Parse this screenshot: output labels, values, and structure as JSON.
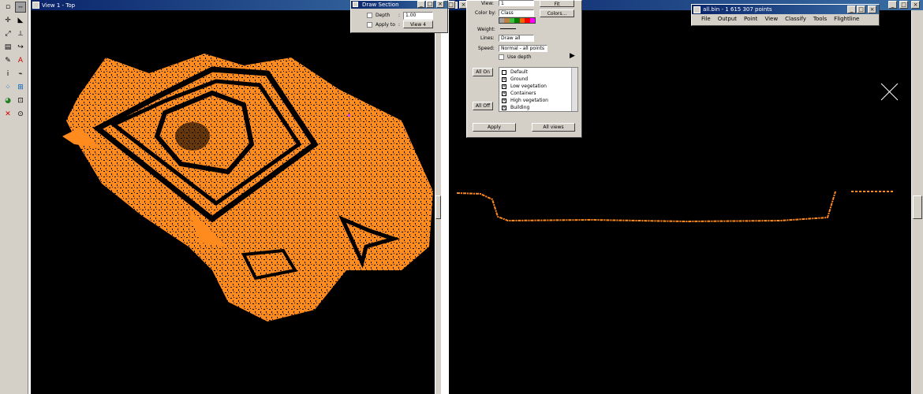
{
  "toolbar": {
    "tools": [
      {
        "icon": "point-select-icon",
        "glyph": "▫"
      },
      {
        "icon": "draw-line-icon",
        "glyph": "╌"
      },
      {
        "icon": "cross-icon",
        "glyph": "✛"
      },
      {
        "icon": "triangle-icon",
        "glyph": "◣"
      },
      {
        "icon": "polyline-icon",
        "glyph": "⤢"
      },
      {
        "icon": "measure-icon",
        "glyph": "⟂"
      },
      {
        "icon": "window-icon",
        "glyph": "▤"
      },
      {
        "icon": "curve-icon",
        "glyph": "↪"
      },
      {
        "icon": "paint-icon",
        "glyph": "✎"
      },
      {
        "icon": "text-icon",
        "glyph": "A"
      },
      {
        "icon": "info-icon",
        "glyph": "ⅰ"
      },
      {
        "icon": "path-icon",
        "glyph": "⌁"
      },
      {
        "icon": "distribute-icon",
        "glyph": "⁘"
      },
      {
        "icon": "grid-icon",
        "glyph": "⊞"
      },
      {
        "icon": "palette-icon",
        "glyph": "◕"
      },
      {
        "icon": "fit-icon",
        "glyph": "⊡"
      },
      {
        "icon": "delete-icon",
        "glyph": "✕"
      },
      {
        "icon": "zoom-icon",
        "glyph": "⊙"
      }
    ]
  },
  "view1": {
    "title": "View 1 - Top"
  },
  "view2": {
    "title": "V"
  },
  "draw_section": {
    "title": "Draw Section",
    "depth_label": "Depth",
    "depth_value": "1.00",
    "apply_label": "Apply to",
    "apply_value": "View 4"
  },
  "display": {
    "view_label": "View:",
    "view_value": "1",
    "fit_label": "Fit",
    "color_label": "Color by:",
    "color_value": "Class",
    "colors_label": "Colors...",
    "weight_label": "Weight:",
    "lines_label": "Lines:",
    "lines_value": "Draw all",
    "speed_label": "Speed:",
    "speed_value": "Normal - all points",
    "use_depth_label": "Use depth",
    "all_on_label": "All On",
    "all_off_label": "All Off",
    "classes": [
      "Default",
      "Ground",
      "Low vegetation",
      "Containers",
      "High vegetation",
      "Building"
    ],
    "apply_label": "Apply",
    "all_views_label": "All views",
    "color_swatches": [
      "#a0a0a0",
      "#c08040",
      "#40c040",
      "#008000",
      "#ff6000",
      "#ff0000",
      "#ff00ff"
    ]
  },
  "main_window": {
    "title": "all.bin - 1 615 307 points",
    "menu": [
      "File",
      "Output",
      "Point",
      "View",
      "Classify",
      "Tools",
      "Flightline"
    ]
  },
  "colors": {
    "point_color": "#ff8a1e",
    "titlebar": "#0a246a"
  }
}
